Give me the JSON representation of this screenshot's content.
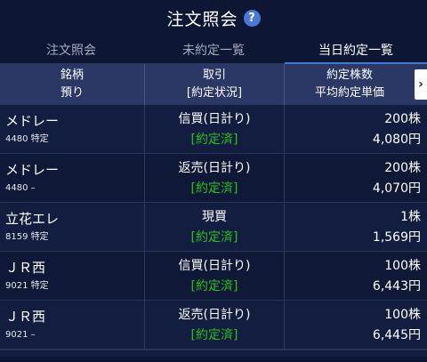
{
  "header": {
    "title": "注文照会"
  },
  "tabs": [
    {
      "label": "注文照会",
      "active": false
    },
    {
      "label": "未約定一覧",
      "active": false
    },
    {
      "label": "当日約定一覧",
      "active": true
    }
  ],
  "columns": {
    "c1_top": "銘柄",
    "c1_bottom": "預り",
    "c2_top": "取引",
    "c2_bottom": "[約定状況]",
    "c3_top": "約定株数",
    "c3_bottom": "平均約定単価"
  },
  "nav": {
    "next_icon": "›"
  },
  "rows": [
    {
      "name": "メドレー",
      "code_account": "4480 特定",
      "trade": "信買(日計り)",
      "status": "[約定済]",
      "quantity": "200株",
      "price": "4,080円"
    },
    {
      "name": "メドレー",
      "code_account": "4480 –",
      "trade": "返売(日計り)",
      "status": "[約定済]",
      "quantity": "200株",
      "price": "4,070円"
    },
    {
      "name": "立花エレ",
      "code_account": "8159 特定",
      "trade": "現買",
      "status": "[約定済]",
      "quantity": "1株",
      "price": "1,569円"
    },
    {
      "name": "ＪＲ西",
      "code_account": "9021 特定",
      "trade": "信買(日計り)",
      "status": "[約定済]",
      "quantity": "100株",
      "price": "6,443円"
    },
    {
      "name": "ＪＲ西",
      "code_account": "9021 –",
      "trade": "返売(日計り)",
      "status": "[約定済]",
      "quantity": "100株",
      "price": "6,445円"
    }
  ],
  "colors": {
    "background": "#0d1633",
    "header_row": "#2b3764",
    "status_green": "#24c41c",
    "tab_accent": "#3e7ad8"
  }
}
